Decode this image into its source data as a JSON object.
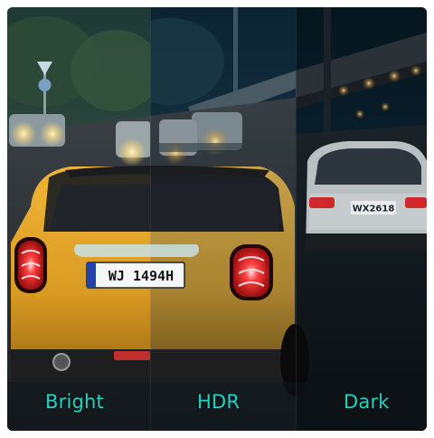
{
  "labels": {
    "bright": "Bright",
    "hdr": "HDR",
    "dark": "Dark"
  },
  "plates": {
    "front_car": "WJ 1494H",
    "right_car": "WX2618"
  },
  "colors": {
    "accent": "#1fd3c6",
    "car_body": "#e0a52a",
    "taillight": "#ff3a3a"
  }
}
